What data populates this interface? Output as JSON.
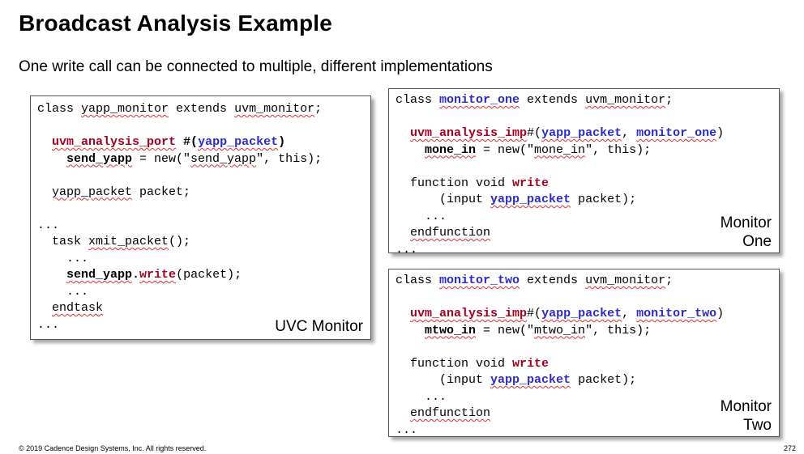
{
  "slide": {
    "title": "Broadcast Analysis Example",
    "subtitle": "One write call can be connected to multiple, different implementations",
    "footer": "© 2019 Cadence Design Systems, Inc. All rights reserved.",
    "page_number": "272"
  },
  "boxes": {
    "uvc_monitor": {
      "label": [
        "UVC Monitor"
      ],
      "lines": [
        [
          {
            "t": "class "
          },
          {
            "t": "yapp_monitor",
            "w": 1
          },
          {
            "t": " extends "
          },
          {
            "t": "uvm_monitor",
            "w": 1
          },
          {
            "t": ";"
          }
        ],
        [],
        [
          {
            "t": "  "
          },
          {
            "t": "uvm_analysis_port",
            "c": "red",
            "w": 1
          },
          {
            "t": " #(",
            "c": "bold"
          },
          {
            "t": "yapp_packet",
            "c": "blue",
            "w": 1
          },
          {
            "t": ")",
            "c": "bold"
          }
        ],
        [
          {
            "t": "    "
          },
          {
            "t": "send_yapp",
            "c": "bold",
            "w": 1
          },
          {
            "t": " = new(\""
          },
          {
            "t": "send_yapp",
            "w": 1
          },
          {
            "t": "\", this);"
          }
        ],
        [],
        [
          {
            "t": "  "
          },
          {
            "t": "yapp_packet",
            "w": 1
          },
          {
            "t": " packet;"
          }
        ],
        [],
        [
          {
            "t": "..."
          }
        ],
        [
          {
            "t": "  task "
          },
          {
            "t": "xmit_packet",
            "w": 1
          },
          {
            "t": "();"
          }
        ],
        [
          {
            "t": "    ..."
          }
        ],
        [
          {
            "t": "    "
          },
          {
            "t": "send_yapp",
            "c": "bold",
            "w": 1
          },
          {
            "t": ".",
            "c": "bold"
          },
          {
            "t": "write",
            "c": "red",
            "w": 1
          },
          {
            "t": "(packet);"
          }
        ],
        [
          {
            "t": "    ..."
          }
        ],
        [
          {
            "t": "  "
          },
          {
            "t": "endtask",
            "w": 1
          }
        ],
        [
          {
            "t": "..."
          }
        ]
      ]
    },
    "monitor_one": {
      "label": [
        "Monitor",
        "One"
      ],
      "lines": [
        [
          {
            "t": "class "
          },
          {
            "t": "monitor_one",
            "c": "blue",
            "w": 1
          },
          {
            "t": " extends "
          },
          {
            "t": "uvm_monitor",
            "w": 1
          },
          {
            "t": ";"
          }
        ],
        [],
        [
          {
            "t": "  "
          },
          {
            "t": "uvm_analysis_imp",
            "c": "red",
            "w": 1
          },
          {
            "t": "#("
          },
          {
            "t": "yapp_packet",
            "c": "blue",
            "w": 1
          },
          {
            "t": ", "
          },
          {
            "t": "monitor_one",
            "c": "blue",
            "w": 1
          },
          {
            "t": ")"
          }
        ],
        [
          {
            "t": "    "
          },
          {
            "t": "mone_in",
            "c": "bold",
            "w": 1
          },
          {
            "t": " = new(\""
          },
          {
            "t": "mone_in",
            "w": 1
          },
          {
            "t": "\", this);"
          }
        ],
        [],
        [
          {
            "t": "  function void "
          },
          {
            "t": "write",
            "c": "red"
          }
        ],
        [
          {
            "t": "      (input "
          },
          {
            "t": "yapp_packet",
            "c": "blue",
            "w": 1
          },
          {
            "t": " packet);"
          }
        ],
        [
          {
            "t": "    ..."
          }
        ],
        [
          {
            "t": "  "
          },
          {
            "t": "endfunction",
            "w": 1
          }
        ],
        [
          {
            "t": "..."
          }
        ]
      ]
    },
    "monitor_two": {
      "label": [
        "Monitor",
        "Two"
      ],
      "lines": [
        [
          {
            "t": "class "
          },
          {
            "t": "monitor_two",
            "c": "blue",
            "w": 1
          },
          {
            "t": " extends "
          },
          {
            "t": "uvm_monitor",
            "w": 1
          },
          {
            "t": ";"
          }
        ],
        [],
        [
          {
            "t": "  "
          },
          {
            "t": "uvm_analysis_imp",
            "c": "red",
            "w": 1
          },
          {
            "t": "#("
          },
          {
            "t": "yapp_packet",
            "c": "blue",
            "w": 1
          },
          {
            "t": ", "
          },
          {
            "t": "monitor_two",
            "c": "blue",
            "w": 1
          },
          {
            "t": ")"
          }
        ],
        [
          {
            "t": "    "
          },
          {
            "t": "mtwo_in",
            "c": "bold",
            "w": 1
          },
          {
            "t": " = new(\""
          },
          {
            "t": "mtwo_in",
            "w": 1
          },
          {
            "t": "\", this);"
          }
        ],
        [],
        [
          {
            "t": "  function void "
          },
          {
            "t": "write",
            "c": "red"
          }
        ],
        [
          {
            "t": "      (input "
          },
          {
            "t": "yapp_packet",
            "c": "blue",
            "w": 1
          },
          {
            "t": " packet);"
          }
        ],
        [
          {
            "t": "    ..."
          }
        ],
        [
          {
            "t": "  "
          },
          {
            "t": "endfunction",
            "w": 1
          }
        ],
        [
          {
            "t": "..."
          }
        ]
      ]
    }
  }
}
